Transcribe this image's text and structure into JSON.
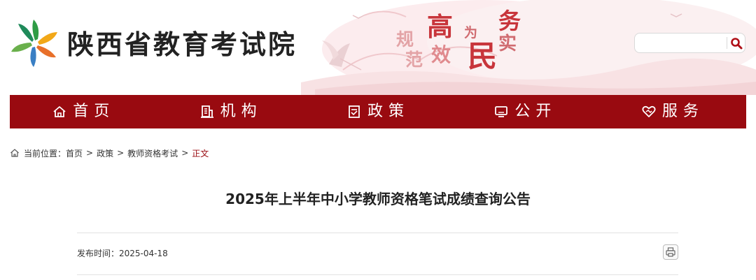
{
  "header": {
    "site_title": "陕西省教育考试院",
    "slogan": [
      "规",
      "范",
      "高",
      "效",
      "为",
      "民",
      "务",
      "实"
    ],
    "search": {
      "value": "",
      "placeholder": ""
    }
  },
  "nav": {
    "items": [
      {
        "label": "首页",
        "icon": "home-icon"
      },
      {
        "label": "机构",
        "icon": "building-icon"
      },
      {
        "label": "政策",
        "icon": "document-icon"
      },
      {
        "label": "公开",
        "icon": "monitor-icon"
      },
      {
        "label": "服务",
        "icon": "heart-handshake-icon"
      }
    ]
  },
  "breadcrumb": {
    "prefix": "当前位置：",
    "items": [
      "首页",
      "政策",
      "教师资格考试"
    ],
    "separator": ">",
    "current": "正文"
  },
  "article": {
    "title": "2025年上半年中小学教师资格笔试成绩查询公告",
    "publish_label": "发布时间：",
    "publish_date": "2025-04-18"
  },
  "colors": {
    "brand_red": "#990a10",
    "slogan_red": "#c8353b",
    "text": "#333333"
  }
}
